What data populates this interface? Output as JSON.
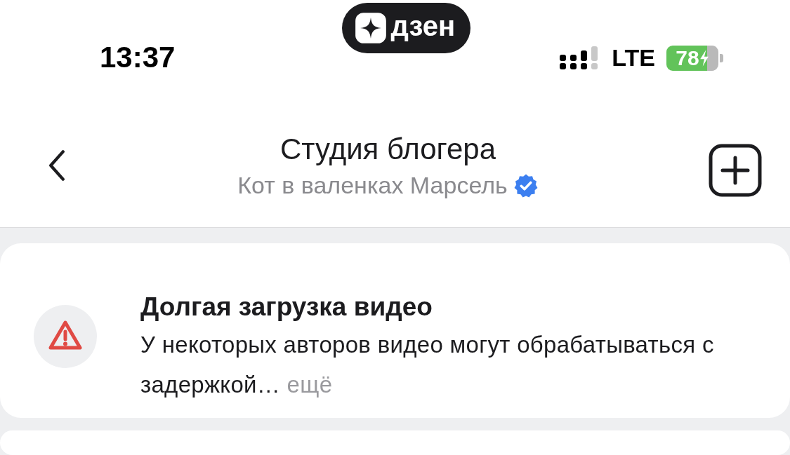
{
  "status_bar": {
    "time": "13:37",
    "logo_text": "дзен",
    "network": "LTE",
    "battery": "78",
    "charging": true
  },
  "header": {
    "title": "Студия блогера",
    "subtitle": "Кот в валенках Марсель",
    "verified": true
  },
  "notice": {
    "title": "Долгая загрузка видео",
    "text": "У некоторых авторов видео могут обрабатываться с задержкой…",
    "more_link": "ещё"
  }
}
